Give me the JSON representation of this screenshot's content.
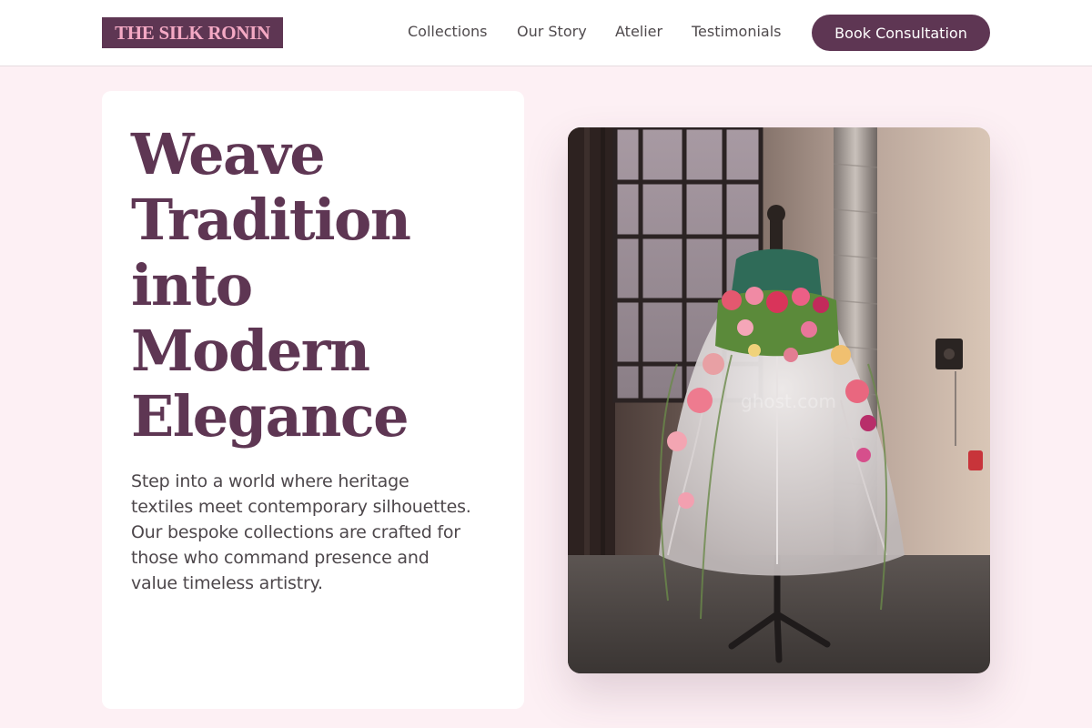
{
  "brand": {
    "name": "THE SILK RONIN"
  },
  "nav": {
    "items": [
      {
        "label": "Collections"
      },
      {
        "label": "Our Story"
      },
      {
        "label": "Atelier"
      },
      {
        "label": "Testimonials"
      }
    ],
    "cta_label": "Book Consultation"
  },
  "hero": {
    "title_lines": [
      "Weave",
      "Tradition",
      "into",
      "Modern",
      "Elegance"
    ],
    "subtitle_lines": [
      "Step into a world where heritage",
      "textiles meet contemporary silhouettes.",
      "Our bespoke collections are crafted for",
      "those who command presence and",
      "value timeless artistry."
    ],
    "image": {
      "subject": "floral dress on dress form in industrial studio",
      "watermark": "ghost.com"
    }
  },
  "colors": {
    "accent": "#5e3653",
    "logo_text": "#f4a9c4",
    "page_bg": "#fdf0f4",
    "card_bg": "#ffffff",
    "body_text": "#4d474b"
  }
}
